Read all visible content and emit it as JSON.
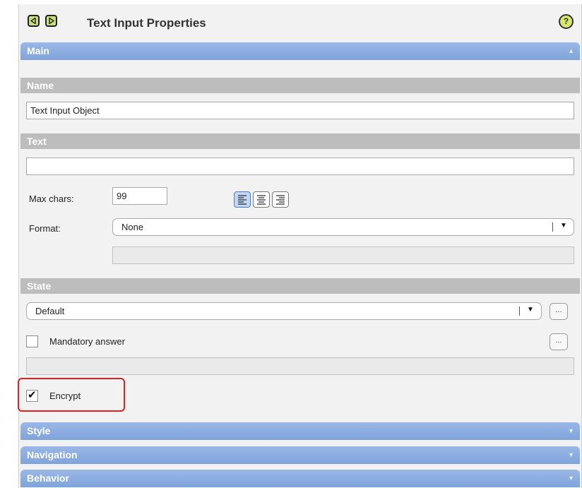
{
  "header": {
    "title": "Text Input Properties",
    "back_icon": "triangle-left-icon",
    "forward_icon": "triangle-right-icon",
    "help_icon": "help-icon",
    "help_glyph": "?"
  },
  "sections": {
    "main": "Main",
    "name": "Name",
    "text": "Text",
    "state": "State",
    "style": "Style",
    "navigation": "Navigation",
    "behavior": "Behavior"
  },
  "name": {
    "value": "Text Input Object"
  },
  "text": {
    "value": "",
    "max_chars_label": "Max chars:",
    "max_chars_value": "99",
    "format_label": "Format:",
    "format_value": "None",
    "format_extra": ""
  },
  "state": {
    "value": "Default",
    "ellipsis": "...",
    "mandatory_label": "Mandatory answer",
    "mandatory_checked": false,
    "mandatory_ellipsis": "...",
    "mandatory_extra": "",
    "encrypt_label": "Encrypt",
    "encrypt_checked": true,
    "check_glyph": "✔"
  },
  "colors": {
    "accordion": "#8eaee0",
    "section": "#bdbdbd",
    "nav_button": "#c8e07a",
    "highlight": "#e02020"
  }
}
